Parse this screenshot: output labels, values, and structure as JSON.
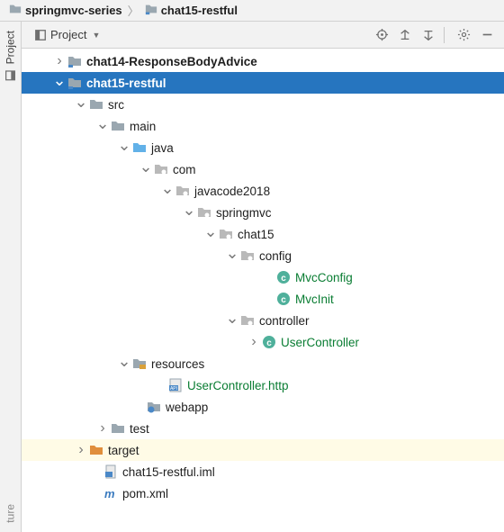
{
  "breadcrumb": {
    "root": "springmvc-series",
    "module": "chat15-restful"
  },
  "sidebar": {
    "project": "Project",
    "structure": "ture"
  },
  "toolbar": {
    "title": "Project"
  },
  "tree": [
    {
      "pad": 34,
      "arrow": ">",
      "icon": "module",
      "label": "chat14-ResponseBodyAdvice",
      "bold": true
    },
    {
      "pad": 34,
      "arrow": "v",
      "icon": "module",
      "label": "chat15-restful",
      "bold": true,
      "selected": true
    },
    {
      "pad": 58,
      "arrow": "v",
      "icon": "folder",
      "label": "src"
    },
    {
      "pad": 82,
      "arrow": "v",
      "icon": "folder",
      "label": "main"
    },
    {
      "pad": 106,
      "arrow": "v",
      "icon": "src-root",
      "label": "java"
    },
    {
      "pad": 130,
      "arrow": "v",
      "icon": "package",
      "label": "com"
    },
    {
      "pad": 154,
      "arrow": "v",
      "icon": "package",
      "label": "javacode2018"
    },
    {
      "pad": 178,
      "arrow": "v",
      "icon": "package",
      "label": "springmvc"
    },
    {
      "pad": 202,
      "arrow": "v",
      "icon": "package",
      "label": "chat15"
    },
    {
      "pad": 226,
      "arrow": "v",
      "icon": "package",
      "label": "config"
    },
    {
      "pad": 266,
      "arrow": "",
      "icon": "class",
      "label": "MvcConfig",
      "green": true
    },
    {
      "pad": 266,
      "arrow": "",
      "icon": "class",
      "label": "MvcInit",
      "green": true
    },
    {
      "pad": 226,
      "arrow": "v",
      "icon": "package",
      "label": "controller"
    },
    {
      "pad": 250,
      "arrow": ">",
      "icon": "class",
      "label": "UserController",
      "green": true
    },
    {
      "pad": 106,
      "arrow": "v",
      "icon": "res-root",
      "label": "resources"
    },
    {
      "pad": 146,
      "arrow": "",
      "icon": "http",
      "label": "UserController.http",
      "green": true
    },
    {
      "pad": 122,
      "arrow": "",
      "icon": "web",
      "label": "webapp"
    },
    {
      "pad": 82,
      "arrow": ">",
      "icon": "folder",
      "label": "test"
    },
    {
      "pad": 58,
      "arrow": ">",
      "icon": "folder-o",
      "label": "target",
      "excluded": true
    },
    {
      "pad": 74,
      "arrow": "",
      "icon": "iml",
      "label": "chat15-restful.iml"
    },
    {
      "pad": 74,
      "arrow": "",
      "icon": "maven",
      "label": "pom.xml"
    }
  ]
}
